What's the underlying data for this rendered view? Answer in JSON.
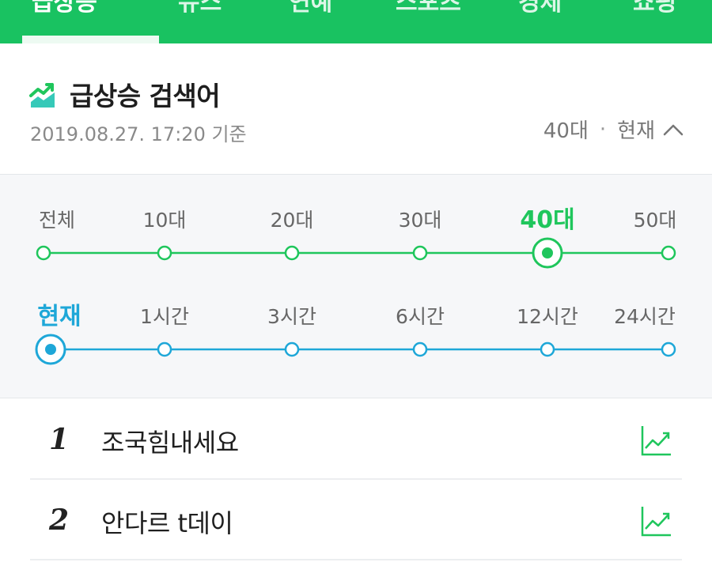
{
  "nav": {
    "tabs": [
      {
        "label": "급상승",
        "active": true
      },
      {
        "label": "뉴스",
        "active": false
      },
      {
        "label": "연예",
        "active": false
      },
      {
        "label": "스포츠",
        "active": false
      },
      {
        "label": "경제",
        "active": false
      },
      {
        "label": "쇼핑",
        "active": false
      }
    ]
  },
  "header": {
    "title": "급상승 검색어",
    "timestamp": "2019.08.27. 17:20 기준",
    "filter_age": "40대",
    "filter_time": "현재"
  },
  "age_filter": {
    "options": [
      "전체",
      "10대",
      "20대",
      "30대",
      "40대",
      "50대"
    ],
    "selected_index": 4
  },
  "time_filter": {
    "options": [
      "현재",
      "1시간",
      "3시간",
      "6시간",
      "12시간",
      "24시간"
    ],
    "selected_index": 0
  },
  "list": {
    "items": [
      {
        "rank": "1",
        "keyword": "조국힘내세요"
      },
      {
        "rank": "2",
        "keyword": "안다르 t데이"
      }
    ]
  },
  "colors": {
    "brand_green": "#19c261",
    "age_green": "#1fc65c",
    "time_blue": "#1ea7d8"
  }
}
